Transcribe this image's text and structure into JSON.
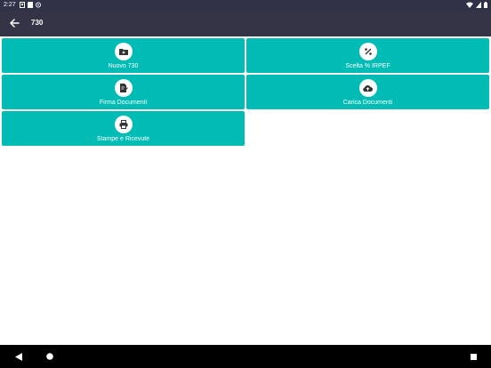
{
  "status_bar": {
    "time": "2:27"
  },
  "toolbar": {
    "title": "730",
    "back_icon": "arrow-left-icon"
  },
  "tiles": [
    {
      "label": "Nuovo 730",
      "icon": "folder-plus-icon"
    },
    {
      "label": "Scelta % IRPEF",
      "icon": "percent-icon"
    },
    {
      "label": "Firma Documenti",
      "icon": "sign-document-icon"
    },
    {
      "label": "Carica Documenti",
      "icon": "cloud-upload-icon"
    },
    {
      "label": "Stampe e Ricevute",
      "icon": "printer-icon"
    }
  ],
  "colors": {
    "accent": "#00bcb4",
    "toolbar": "#353447",
    "status_bar": "#303347"
  }
}
